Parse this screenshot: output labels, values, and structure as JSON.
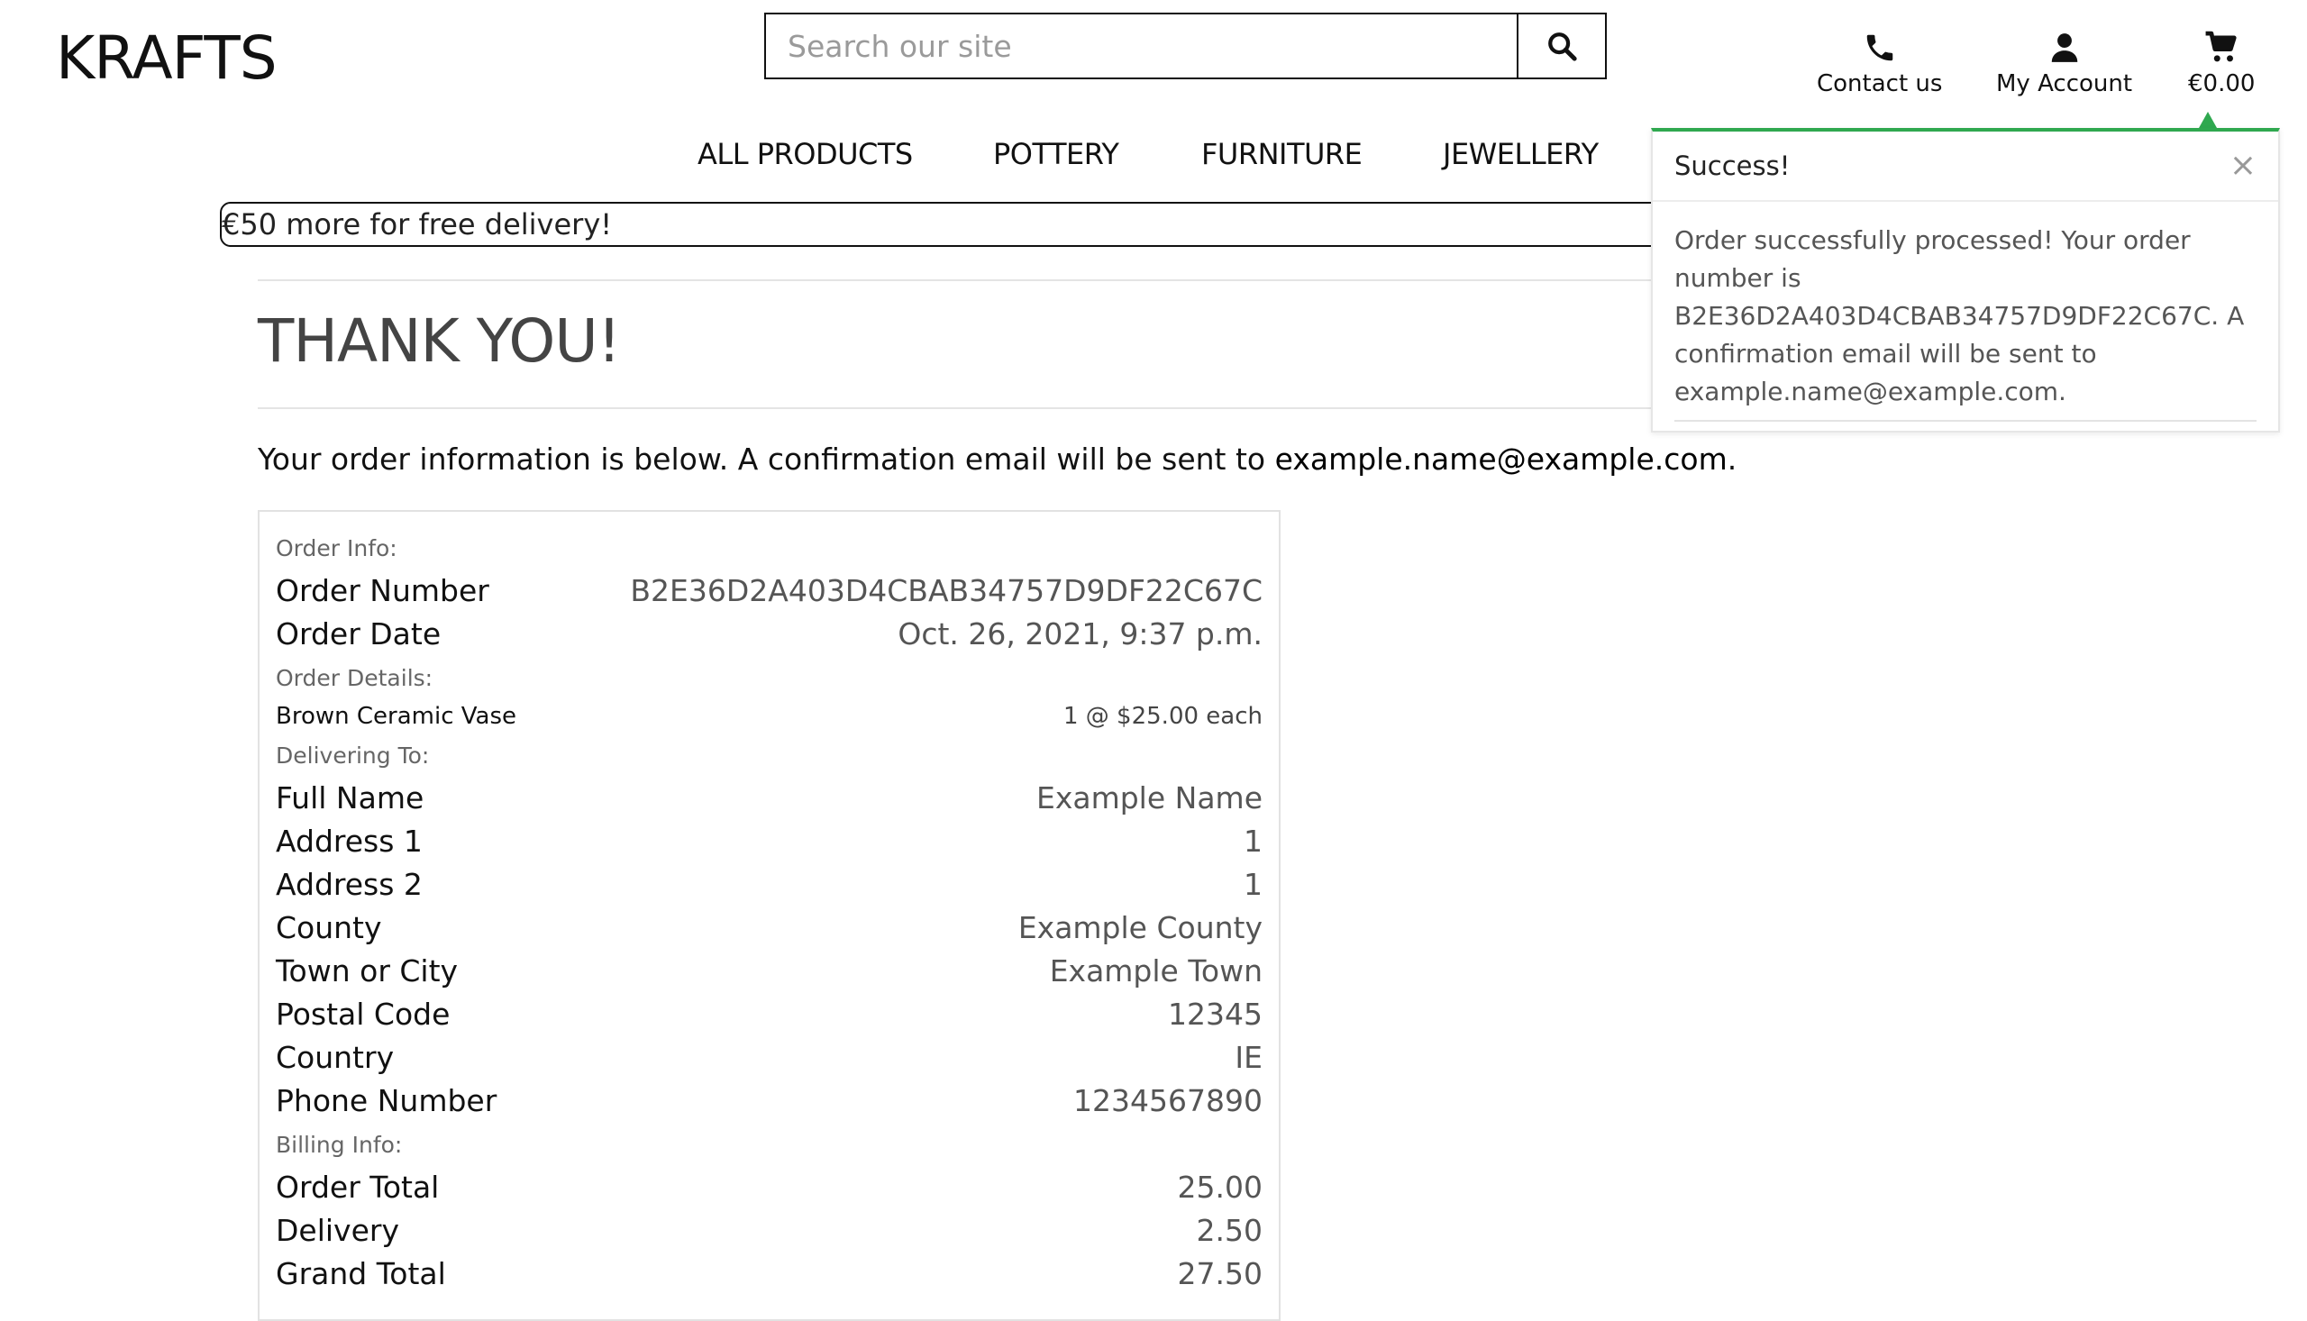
{
  "brand": "KRAFTS",
  "search": {
    "placeholder": "Search our site"
  },
  "top_nav": {
    "contact": "Contact us",
    "account": "My Account",
    "cart_total": "€0.00"
  },
  "main_nav": [
    "ALL PRODUCTS",
    "POTTERY",
    "FURNITURE",
    "JEWELLERY"
  ],
  "banner": "€50 more for free delivery!",
  "page": {
    "title": "THANK YOU!",
    "intro_text": "Your order information is below. A confirmation email will be sent to ",
    "intro_email": "example.name@example.com",
    "intro_end": "."
  },
  "order": {
    "order_info_label": "Order Info:",
    "order_number_label": "Order Number",
    "order_number": "B2E36D2A403D4CBAB34757D9DF22C67C",
    "order_date_label": "Order Date",
    "order_date": "Oct. 26, 2021, 9:37 p.m.",
    "details_label": "Order Details:",
    "item_name": "Brown Ceramic Vase",
    "item_qty": "1 @ $25.00 each",
    "delivering_label": "Delivering To:",
    "full_name_label": "Full Name",
    "full_name": "Example Name",
    "address1_label": "Address 1",
    "address1": "1",
    "address2_label": "Address 2",
    "address2": "1",
    "county_label": "County",
    "county": "Example County",
    "town_label": "Town or City",
    "town": "Example Town",
    "postal_label": "Postal Code",
    "postal": "12345",
    "country_label": "Country",
    "country": "IE",
    "phone_label": "Phone Number",
    "phone": "1234567890",
    "billing_label": "Billing Info:",
    "order_total_label": "Order Total",
    "order_total": "25.00",
    "delivery_label": "Delivery",
    "delivery": "2.50",
    "grand_total_label": "Grand Total",
    "grand_total": "27.50"
  },
  "toast": {
    "title": "Success!",
    "close": "×",
    "message": "Order successfully processed! Your order number is B2E36D2A403D4CBAB34757D9DF22C67C. A confirmation email will be sent to example.name@example.com.",
    "accent_color": "#2fa84f"
  },
  "icons": {
    "search": "search-icon",
    "phone": "phone-icon",
    "user": "user-icon",
    "cart": "cart-icon",
    "close": "close-icon"
  }
}
